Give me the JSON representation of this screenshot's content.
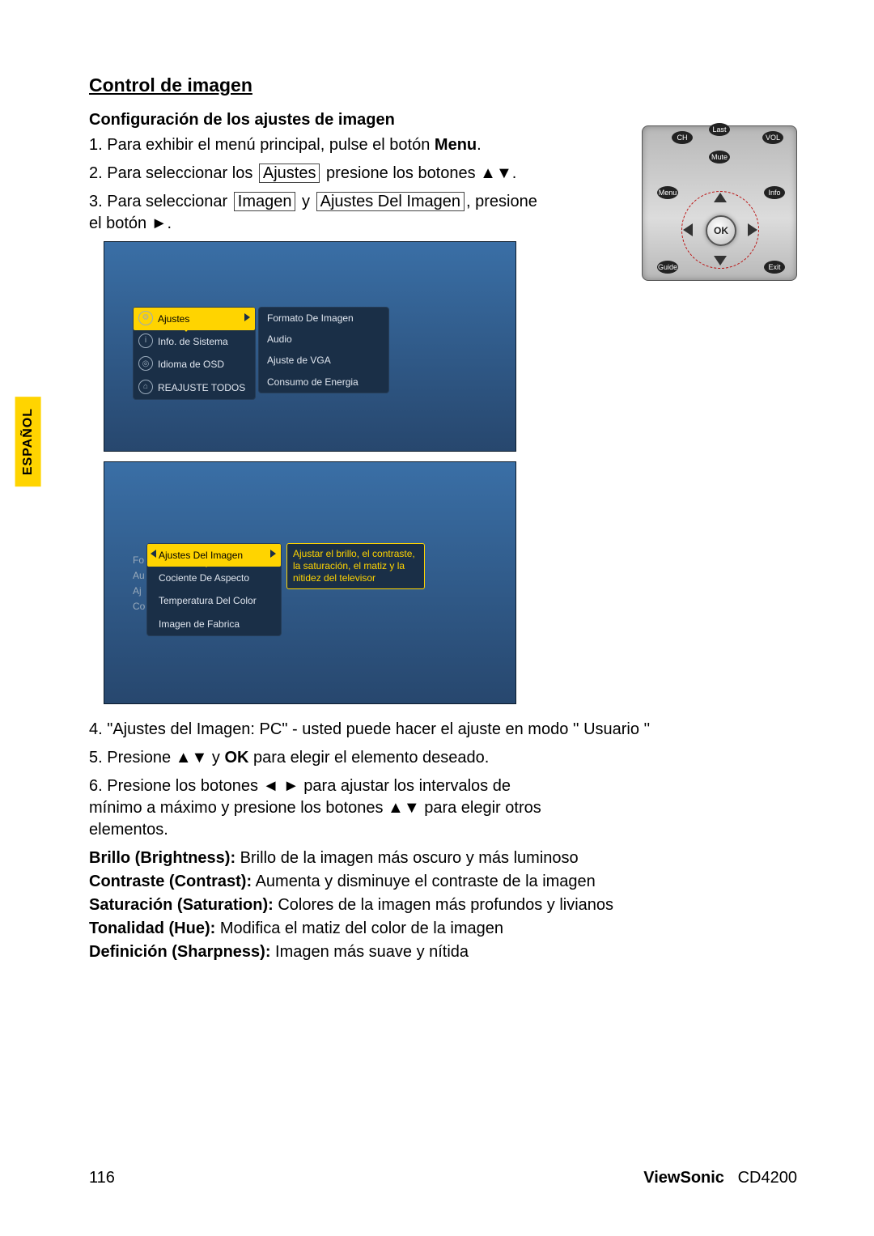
{
  "langtab": "ESPAÑOL",
  "title": "Control de imagen",
  "subtitle": "Configuración de los ajustes de imagen",
  "steps": {
    "s1a": "1. Para exhibir el menú principal, pulse el botón ",
    "s1b": "Menu",
    "s1c": ".",
    "s2a": "2. Para seleccionar los ",
    "s2b": "Ajustes",
    "s2c": " presione los botones ▲▼.",
    "s3a": "3. Para seleccionar ",
    "s3b": "Imagen",
    "s3c": " y ",
    "s3d": "Ajustes Del Imagen",
    "s3e": ", presione el botón ►."
  },
  "remote": {
    "ch": "CH",
    "vol": "VOL",
    "last": "Last",
    "mute": "Mute",
    "menu": "Menu",
    "info": "Info",
    "guide": "Guide",
    "exit": "Exit",
    "ok": "OK"
  },
  "osd1": {
    "left": [
      {
        "label": "Ajustes",
        "sel": true,
        "icon": "⚙"
      },
      {
        "label": "Info. de Sistema",
        "icon": "i"
      },
      {
        "label": "Idioma de OSD",
        "icon": "◎"
      },
      {
        "label": "REAJUSTE TODOS",
        "icon": "⌂"
      }
    ],
    "right": [
      "Formato De Imagen",
      "Audio",
      "Ajuste de VGA",
      "Consumo de Energia"
    ]
  },
  "osd2": {
    "partial": [
      "Fo",
      "Au",
      "Aj",
      "Co"
    ],
    "left": [
      {
        "label": "Ajustes Del Imagen",
        "sel": true
      },
      {
        "label": "Cociente De Aspecto"
      },
      {
        "label": "Temperatura Del Color"
      },
      {
        "label": "Imagen de Fabrica"
      }
    ],
    "tooltip": "Ajustar el brillo, el contraste, la saturación, el matiz y la nitidez del televisor"
  },
  "steps2": {
    "s4": "4. \"Ajustes del Imagen: PC\" - usted puede hacer el ajuste en modo '' Usuario ''",
    "s5a": "5. Presione ▲▼ y ",
    "s5b": "OK",
    "s5c": " para elegir el elemento deseado.",
    "s6": "6. Presione los botones ◄ ► para ajustar los intervalos de mínimo a máximo y presione los botones ▲▼ para elegir otros elementos."
  },
  "defs": [
    {
      "t": "Brillo (Brightness):",
      "d": " Brillo de la imagen más oscuro y más luminoso"
    },
    {
      "t": "Contraste (Contrast):",
      "d": " Aumenta y disminuye el contraste de la imagen"
    },
    {
      "t": "Saturación (Saturation):",
      "d": " Colores de la imagen más profundos y livianos"
    },
    {
      "t": "Tonalidad (Hue):",
      "d": " Modifica el matiz del color de la imagen"
    },
    {
      "t": "Definición (Sharpness):",
      "d": " Imagen más suave y nítida"
    }
  ],
  "footer": {
    "page": "116",
    "brand": "ViewSonic",
    "model": "CD4200"
  }
}
